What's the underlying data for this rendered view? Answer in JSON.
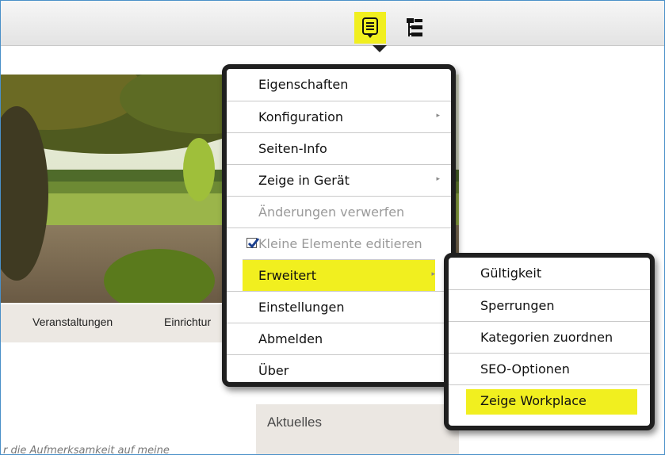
{
  "toolbar": {
    "context_menu_icon": "context-menu-icon",
    "sitemap_icon": "sitemap-tree-icon",
    "active_color": "#f1ef1f"
  },
  "page": {
    "nav_items": [
      "Veranstaltungen",
      "Einrichtur"
    ],
    "aktuelles_title": "Aktuelles",
    "body_text": "r die Aufmerksamkeit auf meine"
  },
  "context_menu": {
    "items": [
      {
        "label": "Eigenschaften",
        "submenu": false,
        "disabled": false
      },
      {
        "label": "Konfiguration",
        "submenu": true,
        "disabled": false
      },
      {
        "label": "Seiten-Info",
        "submenu": false,
        "disabled": false
      },
      {
        "label": "Zeige in Gerät",
        "submenu": true,
        "disabled": false
      },
      {
        "label": "Änderungen verwerfen",
        "submenu": false,
        "disabled": true
      },
      {
        "label": "Kleine Elemente editieren",
        "submenu": false,
        "disabled": true,
        "checked": true
      },
      {
        "label": "Erweitert",
        "submenu": true,
        "disabled": false,
        "highlighted": true
      },
      {
        "label": "Einstellungen",
        "submenu": false,
        "disabled": false
      },
      {
        "label": "Abmelden",
        "submenu": false,
        "disabled": false
      },
      {
        "label": "Über",
        "submenu": false,
        "disabled": false
      }
    ],
    "submenu_arrow": "▸"
  },
  "submenu": {
    "items": [
      {
        "label": "Gültigkeit"
      },
      {
        "label": "Sperrungen"
      },
      {
        "label": "Kategorien zuordnen"
      },
      {
        "label": "SEO-Optionen"
      },
      {
        "label": "Zeige Workplace",
        "highlighted": true
      }
    ]
  },
  "colors": {
    "highlight": "#f1ef1f",
    "menu_border": "#1f1f1f",
    "nav_background": "#ece8e3"
  }
}
